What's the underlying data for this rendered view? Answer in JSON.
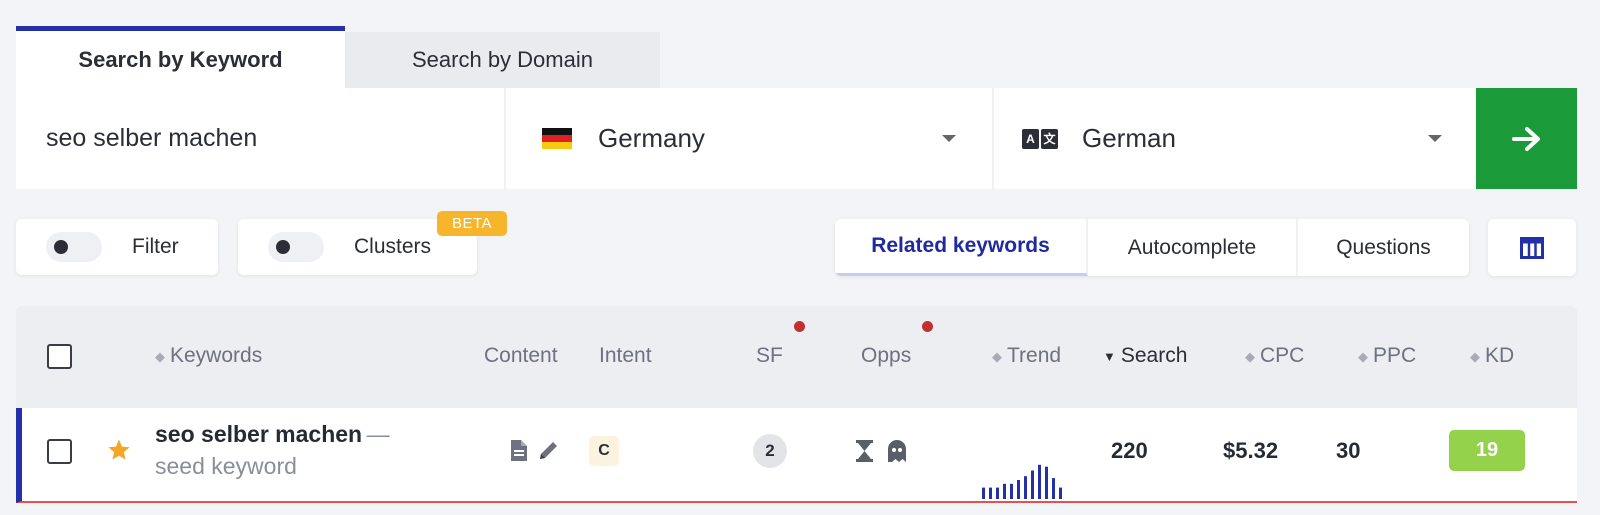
{
  "tabs": {
    "keyword": "Search by Keyword",
    "domain": "Search by Domain"
  },
  "search": {
    "keyword_value": "seo selber machen",
    "country": "Germany",
    "language": "German",
    "lang_icon_glyphs": [
      "A",
      "文"
    ]
  },
  "toolbar": {
    "filter_label": "Filter",
    "clusters_label": "Clusters",
    "beta_badge": "BETA",
    "segments": [
      "Related keywords",
      "Autocomplete",
      "Questions"
    ]
  },
  "table": {
    "headers": {
      "keywords": "Keywords",
      "content": "Content",
      "intent": "Intent",
      "sf": "SF",
      "opps": "Opps",
      "trend": "Trend",
      "search": "Search",
      "cpc": "CPC",
      "ppc": "PPC",
      "kd": "KD"
    },
    "rows": [
      {
        "keyword": "seo selber machen",
        "dash": "—",
        "note": "seed keyword",
        "starred": true,
        "intent": "C",
        "sf": "2",
        "trend": [
          0.3,
          0.3,
          0.3,
          0.4,
          0.4,
          0.5,
          0.6,
          0.75,
          0.9,
          0.85,
          0.55,
          0.3
        ],
        "search": "220",
        "cpc": "$5.32",
        "ppc": "30",
        "kd": "19"
      }
    ]
  },
  "colors": {
    "accent": "#2430a8",
    "go_button": "#1b9a3a",
    "beta": "#f7b52c",
    "kd_easy": "#93d24a",
    "alert_dot": "#c2302f",
    "star": "#f5a623"
  },
  "icons": {
    "go": "arrow-right-icon",
    "columns": "columns-icon",
    "content": [
      "document-icon",
      "pencil-icon"
    ],
    "opps": [
      "hourglass-icon",
      "ghost-icon"
    ],
    "star": "star-icon"
  }
}
